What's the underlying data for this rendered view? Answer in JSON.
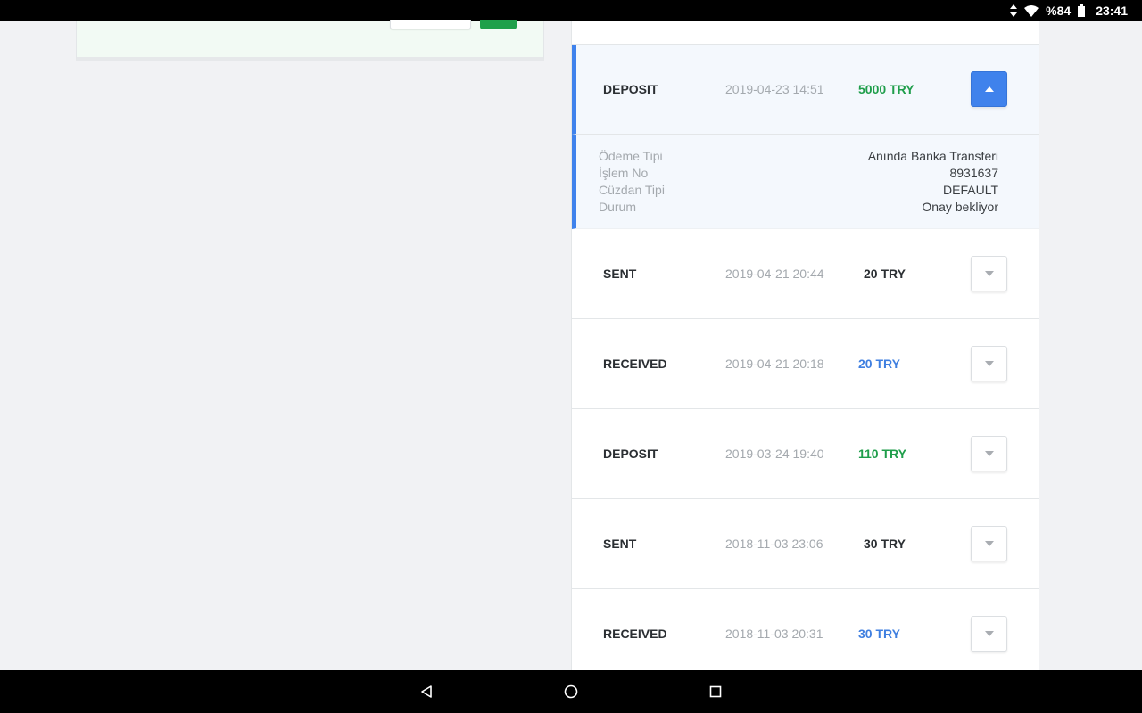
{
  "status_bar": {
    "battery": "%84",
    "time": "23:41"
  },
  "expanded_details": [
    {
      "label": "Ödeme Tipi",
      "value": "Anında Banka Transferi"
    },
    {
      "label": "İşlem No",
      "value": "8931637"
    },
    {
      "label": "Cüzdan Tipi",
      "value": "DEFAULT"
    },
    {
      "label": "Durum",
      "value": "Onay bekliyor"
    }
  ],
  "transactions": [
    {
      "type": "DEPOSIT",
      "date": "2019-04-23 14:51",
      "amount": "5000 TRY"
    },
    {
      "type": "SENT",
      "date": "2019-04-21 20:44",
      "amount": "20 TRY"
    },
    {
      "type": "RECEIVED",
      "date": "2019-04-21 20:18",
      "amount": "20 TRY"
    },
    {
      "type": "DEPOSIT",
      "date": "2019-03-24 19:40",
      "amount": "110 TRY"
    },
    {
      "type": "SENT",
      "date": "2018-11-03 23:06",
      "amount": "30 TRY"
    },
    {
      "type": "RECEIVED",
      "date": "2018-11-03 20:31",
      "amount": "30 TRY"
    }
  ],
  "colors": {
    "accent": "#3f82ec",
    "deposit": "#1f9e4b",
    "received": "#3f7fe0",
    "sent": "#2b2f33"
  }
}
